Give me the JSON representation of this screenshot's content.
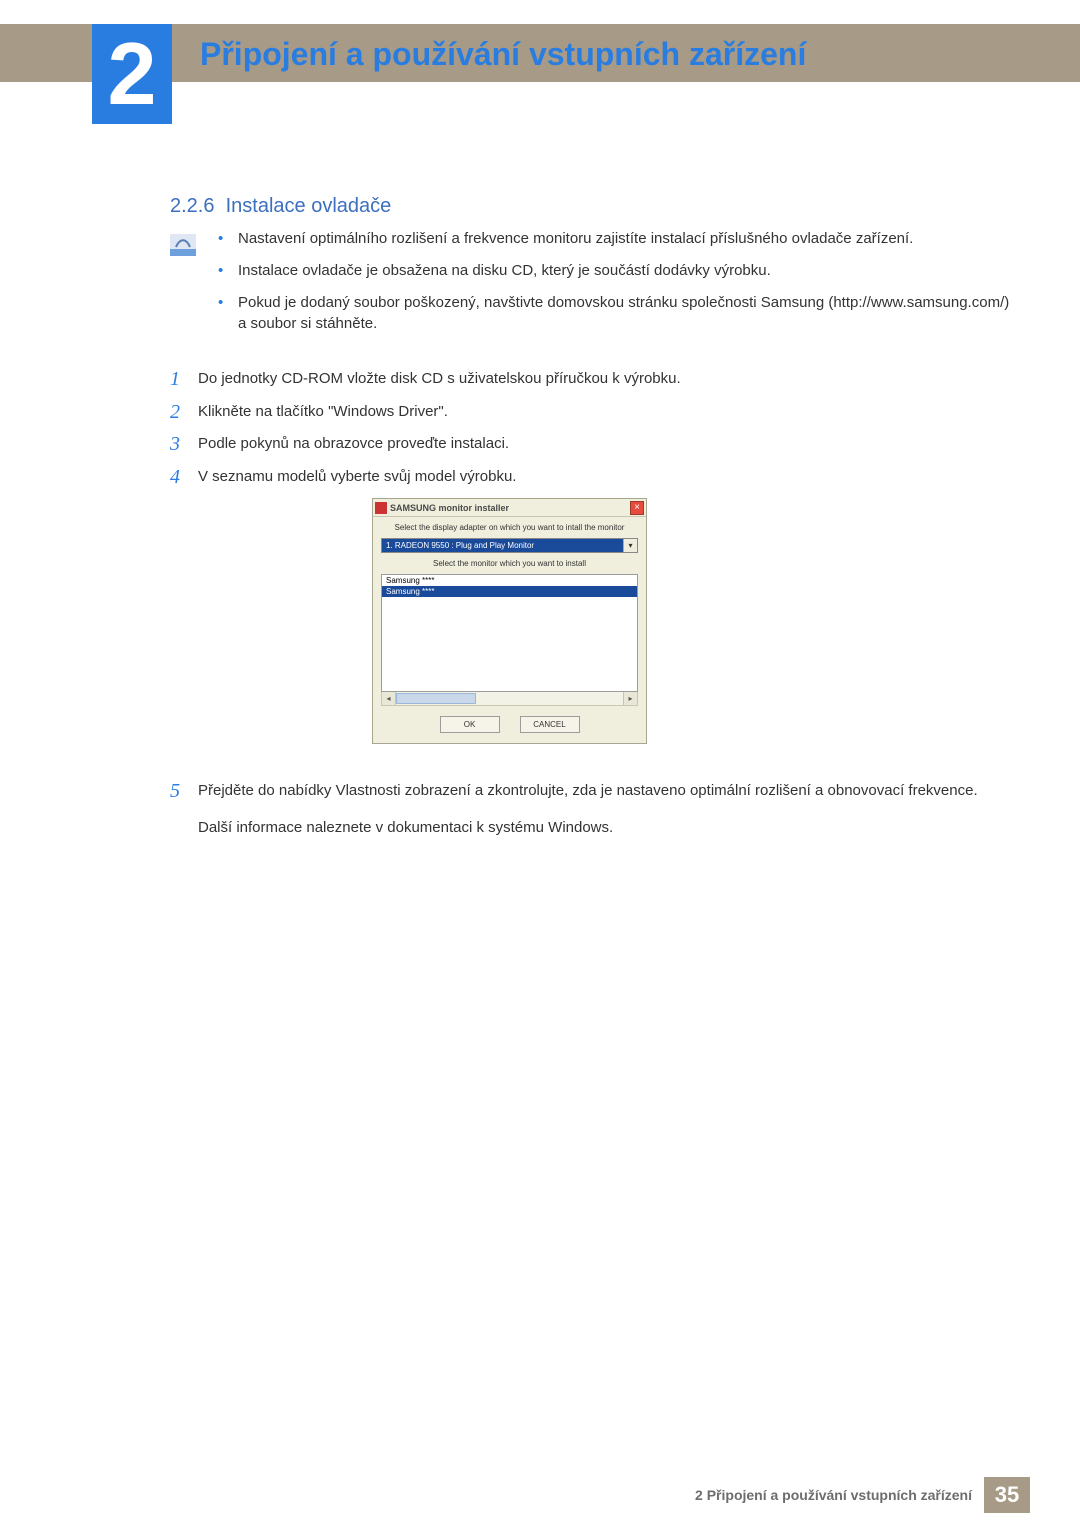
{
  "chapter": {
    "number": "2",
    "title": "Připojení a používání vstupních zařízení"
  },
  "section": {
    "number": "2.2.6",
    "title": "Instalace ovladače"
  },
  "notes": [
    "Nastavení optimálního rozlišení a frekvence monitoru zajistíte instalací příslušného ovladače zařízení.",
    "Instalace ovladače je obsažena na disku CD, který je součástí dodávky výrobku.",
    "Pokud je dodaný soubor poškozený, navštivte domovskou stránku společnosti Samsung (http://www.samsung.com/) a soubor si stáhněte."
  ],
  "steps": {
    "s1": {
      "num": "1",
      "text": "Do jednotky CD-ROM vložte disk CD s uživatelskou příručkou k výrobku."
    },
    "s2": {
      "num": "2",
      "text": "Klikněte na tlačítko \"Windows Driver\"."
    },
    "s3": {
      "num": "3",
      "text": "Podle pokynů na obrazovce proveďte instalaci."
    },
    "s4": {
      "num": "4",
      "text": "V seznamu modelů vyberte svůj model výrobku."
    },
    "s5": {
      "num": "5",
      "text": "Přejděte do nabídky Vlastnosti zobrazení a zkontrolujte, zda je nastaveno optimální rozlišení a obnovovací frekvence.",
      "extra": "Další informace naleznete v dokumentaci k systému Windows."
    }
  },
  "installer": {
    "title": "SAMSUNG monitor installer",
    "label_adapter": "Select the display adapter on which you want to intall the monitor",
    "adapter_value": "1. RADEON 9550 : Plug and Play Monitor",
    "label_monitor": "Select the monitor which you want to install",
    "items": [
      "Samsung ****",
      "Samsung ****"
    ],
    "ok": "OK",
    "cancel": "CANCEL"
  },
  "footer": {
    "label": "2 Připojení a používání vstupních zařízení",
    "page": "35"
  }
}
